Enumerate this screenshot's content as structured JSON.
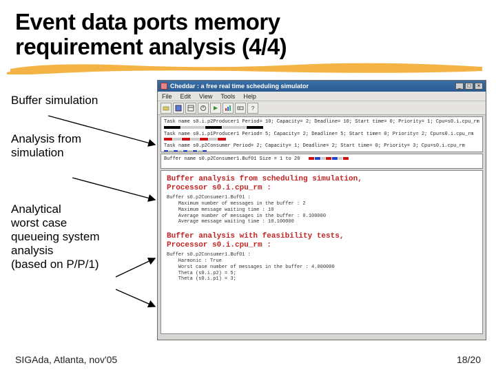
{
  "title_line1": "Event data ports memory",
  "title_line2": "requirement analysis (4/4)",
  "labels": {
    "sim": "Buffer simulation",
    "ana_from_sim_l1": "Analysis from",
    "ana_from_sim_l2": "simulation",
    "analytical_l1": "Analytical",
    "analytical_l2": "worst case",
    "analytical_l3": "queueing system",
    "analytical_l4": "analysis",
    "analytical_l5": "(based on P/P/1)"
  },
  "footer": {
    "left": "SIGAda, Atlanta, nov'05",
    "right": "18/20"
  },
  "app": {
    "title": "Cheddar : a free real time scheduling simulator",
    "menus": [
      "File",
      "Edit",
      "View",
      "Tools",
      "Help"
    ],
    "toolbar_icons": [
      "open-icon",
      "save-icon",
      "tasks-icon",
      "sched-icon",
      "sim-icon",
      "chart-icon",
      "buffer-icon",
      "help-icon"
    ],
    "tasks_header": "Task name  s0.i.p2Producer1     Period= 10; Capacity= 2; Deadline= 10; Start time= 0; Priority= 1; Cpu=s0.i.cpu_rm",
    "tasks_row2": "Task name  s0.i.p1Producer1     Period= 5;  Capacity= 2; Deadline= 5;  Start time= 0; Priority= 2; Cpu=s0.i.cpu_rm",
    "tasks_row3": "Task name  s0.p2Consumer        Period= 2;  Capacity= 1; Deadline= 2;  Start time= 0; Priority= 3; Cpu=s0.i.cpu_rm",
    "buffer_line": "Buffer name  s0.p2Consumer1.Buf01     Size = 1 to 20",
    "results": {
      "h1_l1": "Buffer analysis from scheduling simulation,",
      "h1_l2": "Processor s0.i.cpu_rm :",
      "body1": "Buffer s0.p2Consumer1.Buf01 :\n    Maximum number of messages in the buffer : 2\n    Maximum message waiting time : 10\n    Average number of messages in the buffer : 0.100000\n    Average message waiting time : 10.100000",
      "h2_l1": "Buffer analysis with feasibility tests,",
      "h2_l2": "Processor s0.i.cpu_rm :",
      "body2": "Buffer s0.p2Consumer1.Buf01 :\n    Harmonic : True\n    Worst case number of messages in the buffer : 4.000000\n    Theta (s0.i.p2) = 5;\n    Theta (s0.i.p1) = 3;"
    }
  }
}
